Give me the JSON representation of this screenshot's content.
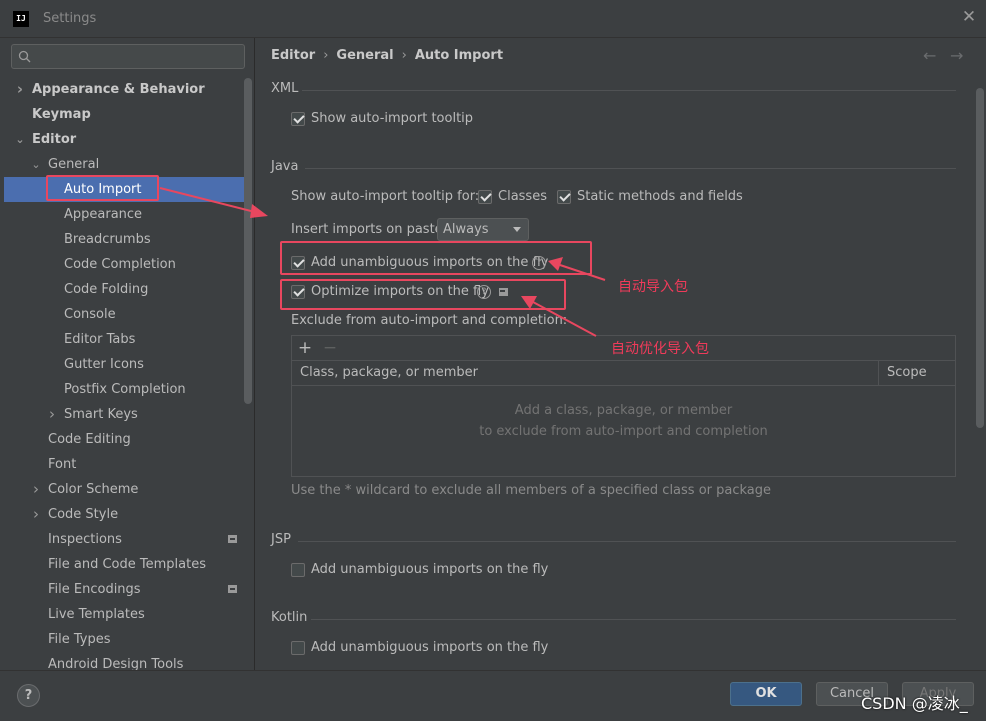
{
  "window": {
    "title": "Settings",
    "logo": "IJ"
  },
  "search": {
    "placeholder": ""
  },
  "tree": [
    {
      "label": "Appearance & Behavior",
      "bold": true,
      "chevron": "right"
    },
    {
      "label": "Keymap",
      "bold": true,
      "chevron": ""
    },
    {
      "label": "Editor",
      "bold": true,
      "chevron": "down"
    },
    {
      "label": "General",
      "chevron": "down"
    },
    {
      "label": "Auto Import",
      "selected": true
    },
    {
      "label": "Appearance"
    },
    {
      "label": "Breadcrumbs"
    },
    {
      "label": "Code Completion"
    },
    {
      "label": "Code Folding"
    },
    {
      "label": "Console"
    },
    {
      "label": "Editor Tabs"
    },
    {
      "label": "Gutter Icons"
    },
    {
      "label": "Postfix Completion"
    },
    {
      "label": "Smart Keys",
      "chevron": "right"
    },
    {
      "label": "Code Editing"
    },
    {
      "label": "Font"
    },
    {
      "label": "Color Scheme",
      "chevron": "right"
    },
    {
      "label": "Code Style",
      "chevron": "right"
    },
    {
      "label": "Inspections",
      "badge": true
    },
    {
      "label": "File and Code Templates"
    },
    {
      "label": "File Encodings",
      "badge": true
    },
    {
      "label": "Live Templates"
    },
    {
      "label": "File Types"
    },
    {
      "label": "Android Design Tools"
    }
  ],
  "breadcrumb": {
    "part1": "Editor",
    "part2": "General",
    "part3": "Auto Import",
    "sep": "›"
  },
  "nav": {
    "back": "←",
    "forward": "→"
  },
  "xml": {
    "title": "XML",
    "show_tooltip": {
      "label": "Show auto-import tooltip",
      "checked": true
    }
  },
  "java": {
    "title": "Java",
    "tooltip_for_label": "Show auto-import tooltip for:",
    "classes": {
      "label": "Classes",
      "checked": true
    },
    "static_methods": {
      "label": "Static methods and fields",
      "checked": true
    },
    "insert_paste_label": "Insert imports on paste:",
    "insert_paste_value": "Always",
    "add_unambiguous": {
      "label": "Add unambiguous imports on the fly",
      "checked": true
    },
    "optimize_imports": {
      "label": "Optimize imports on the fly",
      "checked": true
    },
    "exclude_label": "Exclude from auto-import and completion:",
    "add_btn": "+",
    "remove_btn": "−",
    "col_class": "Class, package, or member",
    "col_scope": "Scope",
    "empty_line1": "Add a class, package, or member",
    "empty_line2": "to exclude from auto-import and completion",
    "wildcard_hint": "Use the * wildcard to exclude all members of a specified class or package"
  },
  "jsp": {
    "title": "JSP",
    "add_unambiguous": {
      "label": "Add unambiguous imports on the fly",
      "checked": false
    }
  },
  "kotlin": {
    "title": "Kotlin",
    "add_unambiguous": {
      "label": "Add unambiguous imports on the fly",
      "checked": false
    }
  },
  "buttons": {
    "help": "?",
    "ok": "OK",
    "cancel": "Cancel",
    "apply": "Apply"
  },
  "annotations": {
    "auto_import": "自动导入包",
    "auto_optimize": "自动优化导入包"
  },
  "watermark": "CSDN @凌冰_",
  "colors": {
    "selection": "#4b6eaf",
    "annotation": "#e8475f",
    "ok_button": "#365880"
  }
}
